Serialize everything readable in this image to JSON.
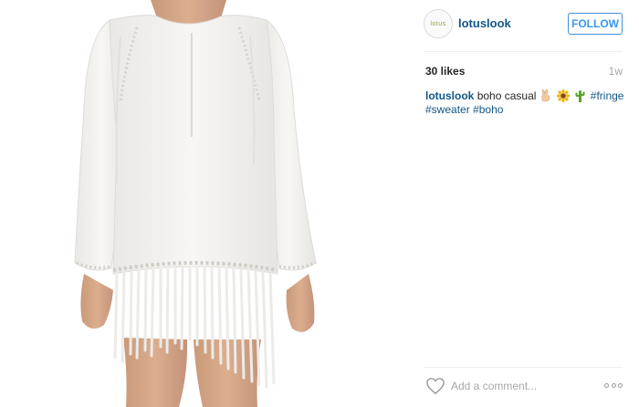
{
  "post": {
    "photo": {
      "icon": "knit-fringe-sweater-photo"
    },
    "header": {
      "avatar_text": "lotus",
      "username": "lotuslook",
      "follow_label": "FOLLOW"
    },
    "likes": "30 likes",
    "time_ago": "1w",
    "caption": {
      "username": "lotuslook",
      "text": "boho casual",
      "emojis": [
        "victory-hand-icon",
        "sunflower-icon",
        "cactus-icon"
      ],
      "hashtags": [
        "#fringe",
        "#sweater",
        "#boho"
      ]
    },
    "footer": {
      "comment_placeholder": "Add a comment...",
      "like_icon": "heart-outline-icon",
      "more_icon": "more-options-icon"
    }
  },
  "colors": {
    "link": "#125688",
    "follow_border": "#4090db",
    "follow_text": "#3897f0",
    "muted": "#a5a7aa",
    "divider": "#efefef"
  }
}
